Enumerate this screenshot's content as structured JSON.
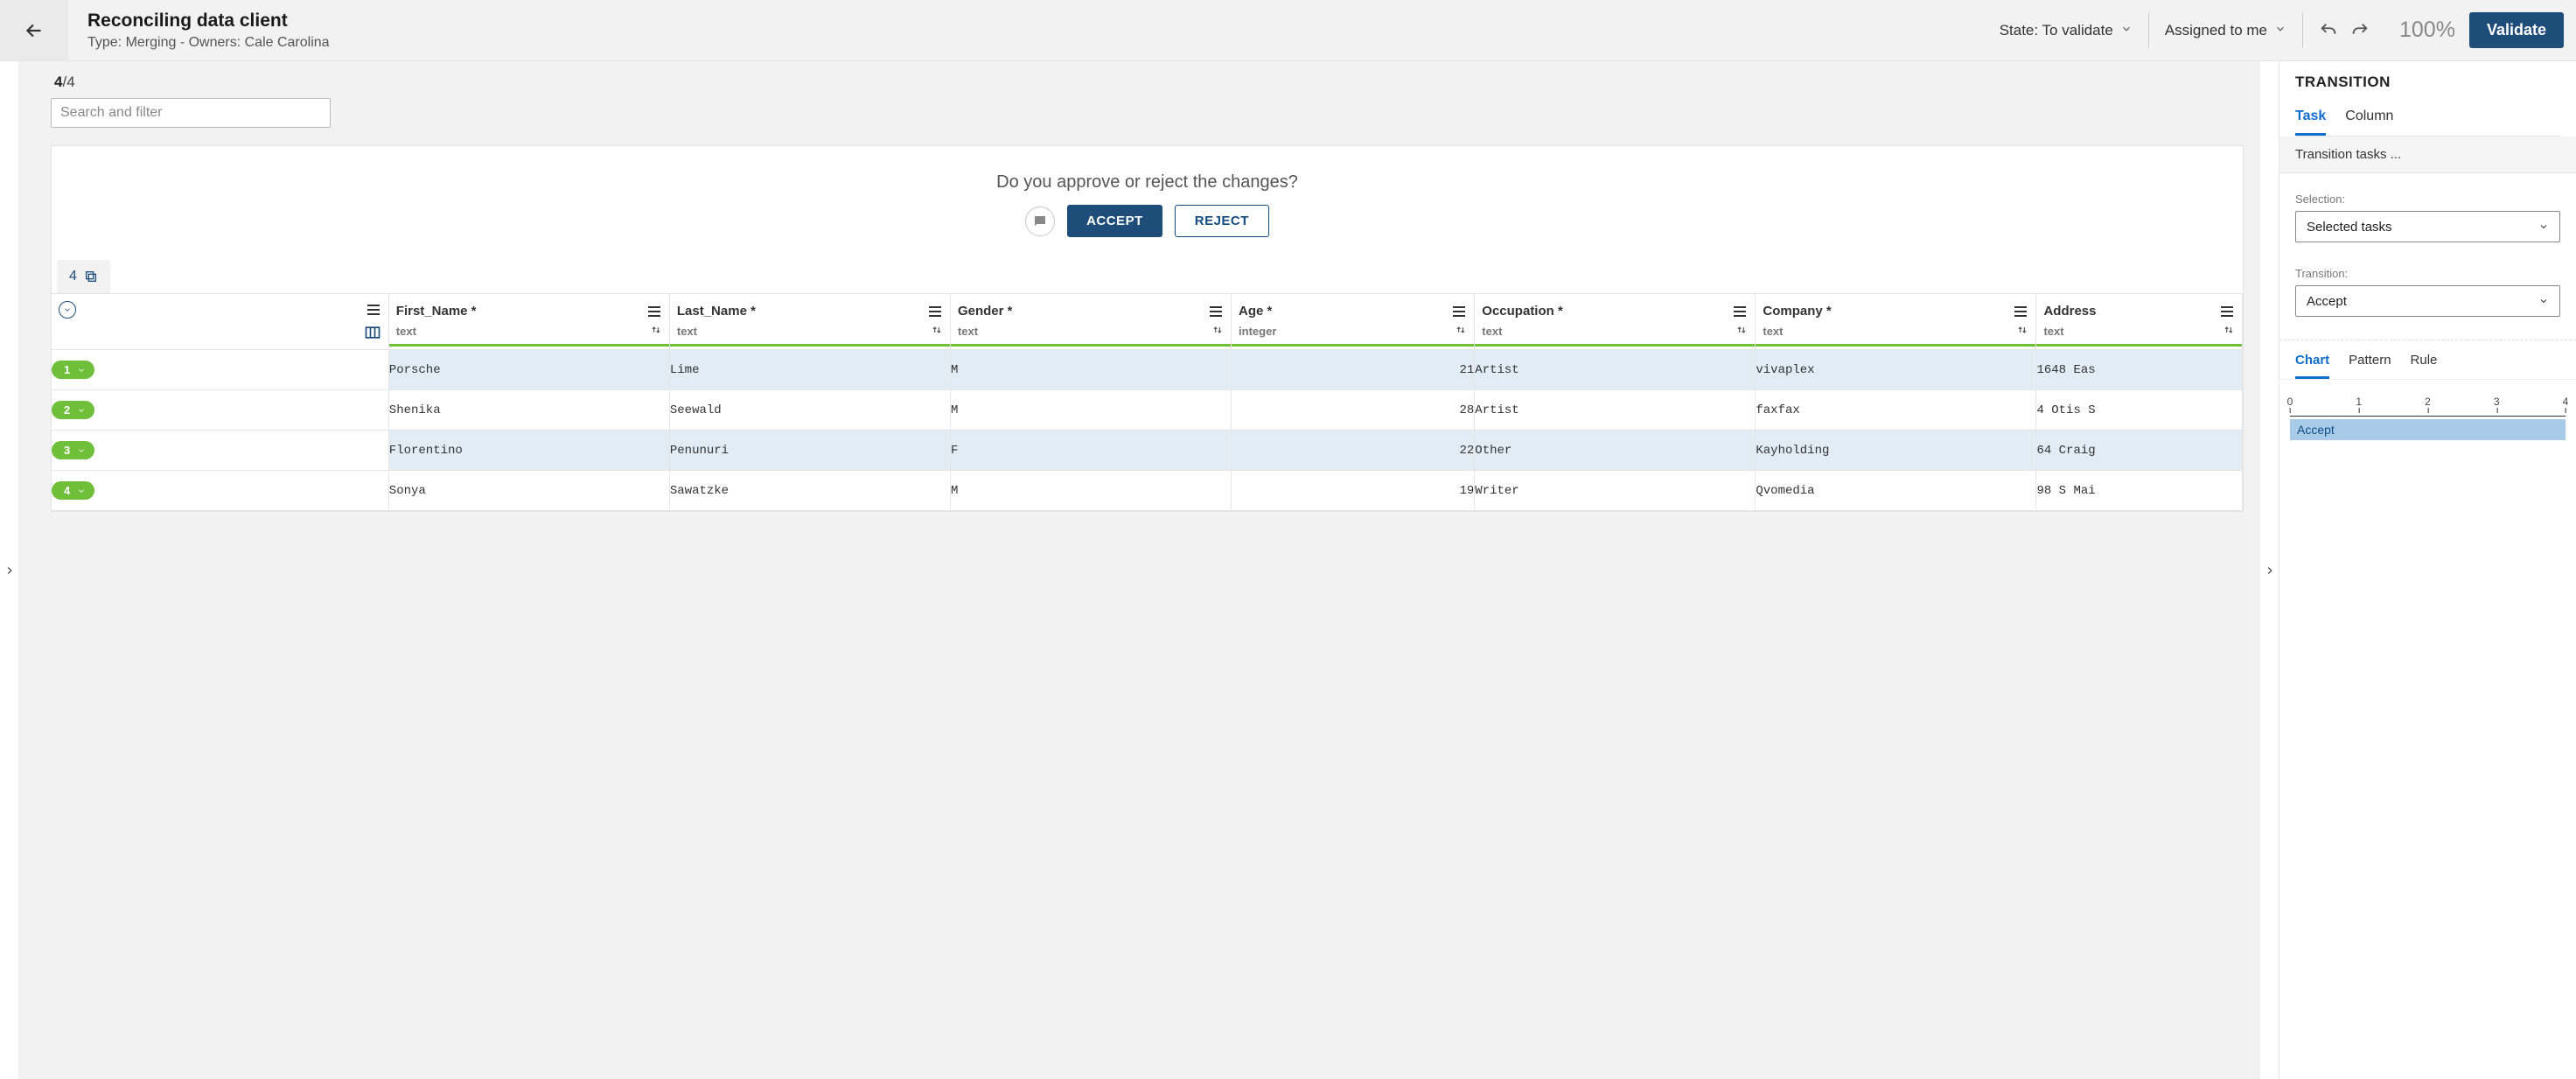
{
  "header": {
    "title": "Reconciling data client",
    "subtitle": "Type: Merging - Owners: Cale Carolina",
    "state_label": "State:",
    "state_value": "To validate",
    "assigned_label": "Assigned to me",
    "zoom": "100%",
    "validate": "Validate"
  },
  "count": {
    "current": "4",
    "total": "/4"
  },
  "search": {
    "placeholder": "Search and filter"
  },
  "approval": {
    "prompt": "Do you approve or reject the changes?",
    "accept": "ACCEPT",
    "reject": "REJECT"
  },
  "rowcount_tab": "4",
  "columns": [
    {
      "name": "First_Name *",
      "type": "text",
      "numeric": false
    },
    {
      "name": "Last_Name *",
      "type": "text",
      "numeric": false
    },
    {
      "name": "Gender *",
      "type": "text",
      "numeric": false
    },
    {
      "name": "Age *",
      "type": "integer",
      "numeric": true
    },
    {
      "name": "Occupation *",
      "type": "text",
      "numeric": false
    },
    {
      "name": "Company *",
      "type": "text",
      "numeric": false
    },
    {
      "name": "Address",
      "type": "text",
      "numeric": false
    }
  ],
  "rows": [
    {
      "n": "1",
      "cells": [
        "Porsche",
        "Lime",
        "M",
        "21",
        "Artist",
        "vivaplex",
        "1648 Eas"
      ]
    },
    {
      "n": "2",
      "cells": [
        "Shenika",
        "Seewald",
        "M",
        "28",
        "Artist",
        "faxfax",
        "4 Otis S"
      ]
    },
    {
      "n": "3",
      "cells": [
        "Florentino",
        "Penunuri",
        "F",
        "22",
        "Other",
        "Kayholding",
        "64 Craig"
      ]
    },
    {
      "n": "4",
      "cells": [
        "Sonya",
        "Sawatzke",
        "M",
        "19",
        "Writer",
        "Qvomedia",
        "98 S Mai"
      ]
    }
  ],
  "side": {
    "title": "TRANSITION",
    "tabs": [
      "Task",
      "Column"
    ],
    "subhead": "Transition tasks ...",
    "selection_label": "Selection:",
    "selection_value": "Selected tasks",
    "transition_label": "Transition:",
    "transition_value": "Accept",
    "chart_tabs": [
      "Chart",
      "Pattern",
      "Rule"
    ]
  },
  "chart_data": {
    "type": "bar",
    "orientation": "horizontal",
    "xlim": [
      0,
      4
    ],
    "ticks": [
      "0",
      "1",
      "2",
      "3",
      "4"
    ],
    "series": [
      {
        "name": "Accept",
        "value": 4
      }
    ]
  }
}
